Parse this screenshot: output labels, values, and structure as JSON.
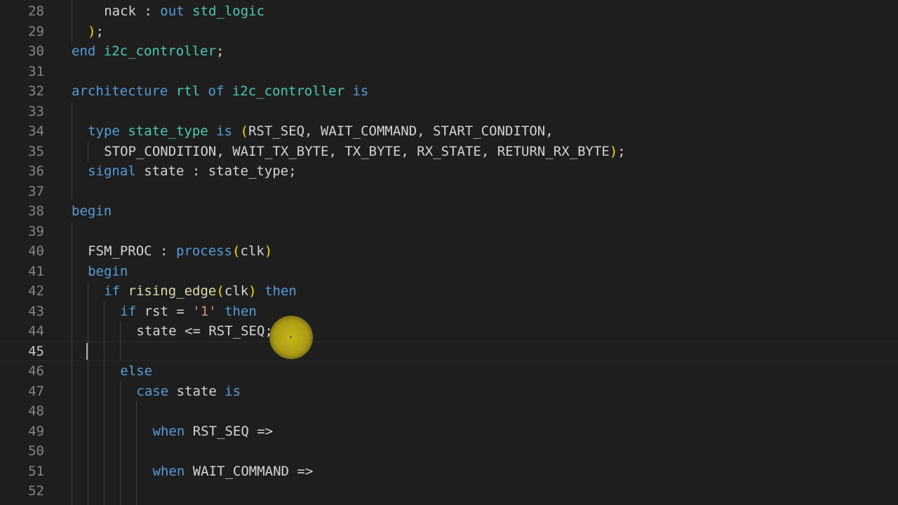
{
  "editor": {
    "current_line": "45",
    "lines": [
      {
        "number": "28",
        "t": [
          [
            "id",
            "nack"
          ],
          [
            "op",
            " : "
          ],
          [
            "kw",
            "out"
          ],
          [
            "op",
            " "
          ],
          [
            "tp",
            "std_logic"
          ]
        ]
      },
      {
        "number": "29",
        "t": [
          [
            "br",
            ")"
          ],
          [
            "op",
            ";"
          ]
        ]
      },
      {
        "number": "30",
        "t": [
          [
            "kw",
            "end"
          ],
          [
            "op",
            " "
          ],
          [
            "tp",
            "i2c_controller"
          ],
          [
            "op",
            ";"
          ]
        ]
      },
      {
        "number": "31",
        "t": []
      },
      {
        "number": "32",
        "t": [
          [
            "kw",
            "architecture"
          ],
          [
            "op",
            " "
          ],
          [
            "tp",
            "rtl"
          ],
          [
            "op",
            " "
          ],
          [
            "kw",
            "of"
          ],
          [
            "op",
            " "
          ],
          [
            "tp",
            "i2c_controller"
          ],
          [
            "op",
            " "
          ],
          [
            "kw",
            "is"
          ]
        ]
      },
      {
        "number": "33",
        "t": []
      },
      {
        "number": "34",
        "t": [
          [
            "kw",
            "type"
          ],
          [
            "op",
            " "
          ],
          [
            "tp",
            "state_type"
          ],
          [
            "op",
            " "
          ],
          [
            "kw",
            "is"
          ],
          [
            "op",
            " "
          ],
          [
            "br",
            "("
          ],
          [
            "id",
            "RST_SEQ, WAIT_COMMAND, START_CONDITON,"
          ]
        ]
      },
      {
        "number": "35",
        "t": [
          [
            "id",
            "STOP_CONDITION, WAIT_TX_BYTE, TX_BYTE, RX_STATE, RETURN_RX_BYTE"
          ],
          [
            "br",
            ")"
          ],
          [
            "op",
            ";"
          ]
        ]
      },
      {
        "number": "36",
        "t": [
          [
            "kw",
            "signal"
          ],
          [
            "op",
            " "
          ],
          [
            "id",
            "state : state_type;"
          ]
        ]
      },
      {
        "number": "37",
        "t": []
      },
      {
        "number": "38",
        "t": [
          [
            "kw",
            "begin"
          ]
        ]
      },
      {
        "number": "39",
        "t": []
      },
      {
        "number": "40",
        "t": [
          [
            "id",
            "FSM_PROC : "
          ],
          [
            "kw",
            "process"
          ],
          [
            "br",
            "("
          ],
          [
            "id",
            "clk"
          ],
          [
            "br",
            ")"
          ]
        ]
      },
      {
        "number": "41",
        "t": [
          [
            "kw",
            "begin"
          ]
        ]
      },
      {
        "number": "42",
        "t": [
          [
            "kw",
            "if"
          ],
          [
            "op",
            " "
          ],
          [
            "fn",
            "rising_edge"
          ],
          [
            "br",
            "("
          ],
          [
            "id",
            "clk"
          ],
          [
            "br",
            ")"
          ],
          [
            "op",
            " "
          ],
          [
            "kw",
            "then"
          ]
        ]
      },
      {
        "number": "43",
        "t": [
          [
            "kw",
            "if"
          ],
          [
            "op",
            " "
          ],
          [
            "id",
            "rst = "
          ],
          [
            "str",
            "'1'"
          ],
          [
            "op",
            " "
          ],
          [
            "kw",
            "then"
          ]
        ]
      },
      {
        "number": "44",
        "t": [
          [
            "id",
            "state <= RST_SEQ;"
          ]
        ]
      },
      {
        "number": "45",
        "t": []
      },
      {
        "number": "46",
        "t": [
          [
            "kw",
            "else"
          ]
        ]
      },
      {
        "number": "47",
        "t": [
          [
            "kw",
            "case"
          ],
          [
            "op",
            " "
          ],
          [
            "id",
            "state"
          ],
          [
            "op",
            " "
          ],
          [
            "kw",
            "is"
          ]
        ]
      },
      {
        "number": "48",
        "t": []
      },
      {
        "number": "49",
        "t": [
          [
            "kw",
            "when"
          ],
          [
            "op",
            " "
          ],
          [
            "id",
            "RST_SEQ =>"
          ]
        ]
      },
      {
        "number": "50",
        "t": []
      },
      {
        "number": "51",
        "t": [
          [
            "kw",
            "when"
          ],
          [
            "op",
            " "
          ],
          [
            "id",
            "WAIT_COMMAND =>"
          ]
        ]
      },
      {
        "number": "52",
        "t": []
      }
    ]
  },
  "colors": {
    "background": "#1e1e1e",
    "keyword": "#569cd6",
    "function": "#dcdcaa",
    "type": "#4ec9b0",
    "string": "#ce9178",
    "bracket": "#ffd700",
    "line_number": "#858585",
    "click_indicator": "#d6c419"
  }
}
